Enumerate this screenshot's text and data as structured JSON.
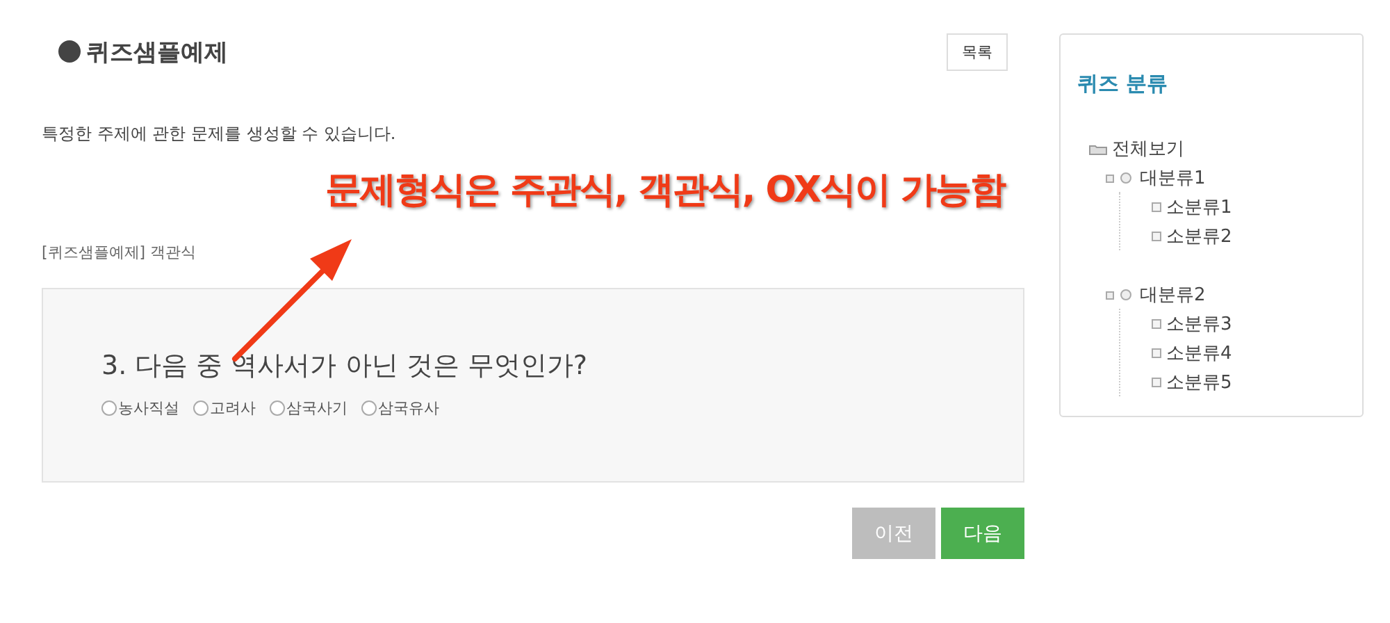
{
  "page": {
    "title": "퀴즈샘플예제",
    "list_button": "목록",
    "description": "특정한 주제에 관한 문제를 생성할 수 있습니다."
  },
  "annotation": {
    "text": "문제형식은 주관식, 객관식, OX식이 가능함"
  },
  "breadcrumb": "[퀴즈샘플예제] 객관식",
  "question": {
    "text": "3. 다음 중 역사서가 아닌 것은 무엇인가?",
    "options": [
      {
        "label": "농사직설",
        "selected": false
      },
      {
        "label": "고려사",
        "selected": false
      },
      {
        "label": "삼국사기",
        "selected": false
      },
      {
        "label": "삼국유사",
        "selected": false
      }
    ]
  },
  "buttons": [
    {
      "label": "이전",
      "kind": "prev"
    },
    {
      "label": "다음",
      "kind": "next"
    }
  ],
  "sidebar": {
    "title": "퀴즈 분류",
    "tree": [
      {
        "label": "전체보기",
        "children": [
          {
            "label": "대분류1",
            "children": [
              {
                "label": "소분류1"
              },
              {
                "label": "소분류2"
              }
            ]
          },
          {
            "label": "대분류2",
            "children": [
              {
                "label": "소분류3"
              },
              {
                "label": "소분류4"
              },
              {
                "label": "소분류5"
              }
            ]
          }
        ]
      }
    ]
  }
}
